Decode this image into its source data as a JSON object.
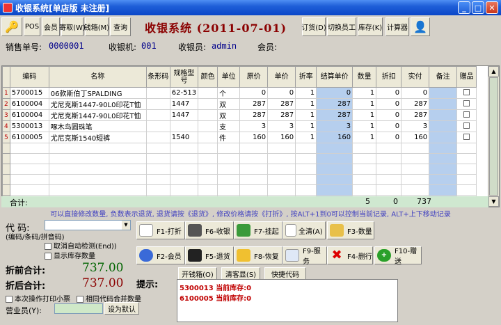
{
  "window": {
    "title": "收银系统[单店版 未注册]"
  },
  "toolbar": {
    "pos": "POS",
    "member": "会员",
    "fetch": "寄取(W)",
    "cashbox": "钱箱(M)",
    "query": "查询",
    "heading": "收银系统 (2011-07-01)",
    "order": "订货(D)",
    "switch_staff": "切换员工",
    "stock": "库存(K)",
    "calculator": "计算器"
  },
  "info": {
    "sale_no_label": "销售单号:",
    "sale_no": "0000001",
    "register_label": "收银机:",
    "register": "001",
    "cashier_label": "收银员:",
    "cashier": "admin",
    "member_label": "会员:"
  },
  "grid": {
    "columns": [
      "编码",
      "名称",
      "条形码",
      "规格型号",
      "颜色",
      "单位",
      "原价",
      "单价",
      "折率",
      "结算单价",
      "数量",
      "折扣",
      "实付",
      "备注",
      "赠品"
    ],
    "rows": [
      {
        "idx": "1",
        "code": "5700015",
        "name": "06款斯伯丁SPALDING",
        "barcode": "",
        "spec": "62-513",
        "color": "",
        "unit": "个",
        "orig": "0",
        "price": "0",
        "rate": "1",
        "settle": "0",
        "qty": "1",
        "disc": "0",
        "paid": "0"
      },
      {
        "idx": "2",
        "code": "6100004",
        "name": "尤尼克斯1447-90L0印花T恤",
        "barcode": "",
        "spec": "1447",
        "color": "",
        "unit": "双",
        "orig": "287",
        "price": "287",
        "rate": "1",
        "settle": "287",
        "qty": "1",
        "disc": "0",
        "paid": "287"
      },
      {
        "idx": "3",
        "code": "6100004",
        "name": "尤尼克斯1447-90L0印花T恤",
        "barcode": "",
        "spec": "1447",
        "color": "",
        "unit": "双",
        "orig": "287",
        "price": "287",
        "rate": "1",
        "settle": "287",
        "qty": "1",
        "disc": "0",
        "paid": "287"
      },
      {
        "idx": "4",
        "code": "5300013",
        "name": "啄木鸟圆珠笔",
        "barcode": "",
        "spec": "",
        "color": "",
        "unit": "支",
        "orig": "3",
        "price": "3",
        "rate": "1",
        "settle": "3",
        "qty": "1",
        "disc": "0",
        "paid": "3"
      },
      {
        "idx": "5",
        "code": "6100005",
        "name": "尤尼克斯1540短裤",
        "barcode": "",
        "spec": "1540",
        "color": "",
        "unit": "件",
        "orig": "160",
        "price": "160",
        "rate": "1",
        "settle": "160",
        "qty": "1",
        "disc": "0",
        "paid": "160"
      }
    ],
    "total_label": "合计:",
    "total_qty": "5",
    "total_disc": "0",
    "total_paid": "737"
  },
  "hint": "可以直接修改数量, 负数表示退货, 退货请按《退货》, 修改价格请按《打折》, 按ALT+1到0可以控制当前记录, ALT+上下移动记录",
  "entry": {
    "code_label": "代 码:",
    "code_sub": "(编码/条码/拼音码)",
    "cancel_auto": "取消自动检测(End))",
    "show_stock": "显示库存数量"
  },
  "totals": {
    "before_label": "折前合计:",
    "before": "737.00",
    "after_label": "折后合计:",
    "after": "737.00"
  },
  "options": {
    "print_receipt": "本次操作打印小票",
    "merge_same": "相同代码合并数量",
    "clerk_label": "营业员(Y):",
    "set_default": "设为默认"
  },
  "actions": {
    "f1": "F1-打折",
    "f6": "F6-收银",
    "f7": "F7-挂起",
    "all_clear": "全清(A)",
    "f3": "F3-数量",
    "f2": "F2-会员",
    "f5": "F5-退货",
    "f8": "F8-恢复",
    "f9": "F9-服务",
    "f4": "F4-删行",
    "f10": "F10-赠送"
  },
  "prompt": {
    "label": "提示:",
    "open_box": "开钱箱(O)",
    "clear_display": "清客显(S)",
    "quick_code": "快捷代码",
    "lines": [
      "5300013 当前库存:0",
      "6100005 当前库存:0"
    ]
  },
  "colors": {
    "heading": "#8b0000",
    "amount": "#006400",
    "settle_col": "#b6cfee",
    "total_row": "#cfe8d0"
  }
}
